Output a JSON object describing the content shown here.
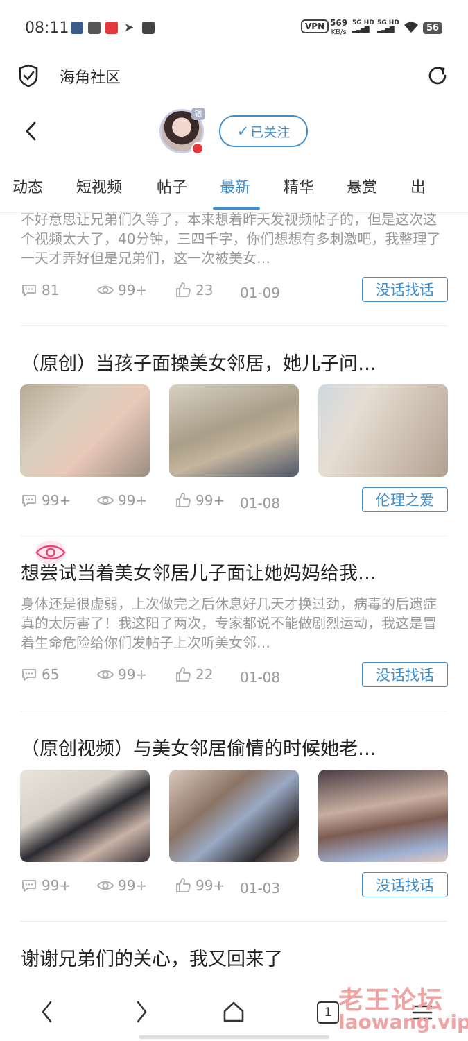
{
  "status_bar": {
    "time": "08:11",
    "net_speed": "569",
    "net_unit": "KB/s",
    "sig1": "5G HD",
    "sig2": "5G HD",
    "vpn": "VPN",
    "battery": "56"
  },
  "app": {
    "title": "海角社区"
  },
  "profile": {
    "badge": "银",
    "follow_label": "已关注"
  },
  "tabs": [
    "动态",
    "短视频",
    "帖子",
    "最新",
    "精华",
    "悬赏",
    "出"
  ],
  "active_tab_index": 3,
  "posts": [
    {
      "title": "",
      "body": "不好意思让兄弟们久等了，本来想着昨天发视频帖子的，但是这次这个视频太大了，40分钟，三四千字，你们想想有多刺激吧，我整理了一天才弄好但是兄弟们，这一次被美女…",
      "comments": "81",
      "views": "99+",
      "likes": "23",
      "date": "01-09",
      "tag": "没话找话"
    },
    {
      "title": "（原创）当孩子面操美女邻居，她儿子问…",
      "comments": "99+",
      "views": "99+",
      "likes": "99+",
      "date": "01-08",
      "tag": "伦理之爱"
    },
    {
      "title": "想尝试当着美女邻居儿子面让她妈妈给我…",
      "body": "身体还是很虚弱，上次做完之后休息好几天才换过劲，病毒的后遗症真的太厉害了！我这阳了两次，专家都说不能做剧烈运动，我这是冒着生命危险给你们发帖子上次听美女邻…",
      "comments": "65",
      "views": "99+",
      "likes": "22",
      "date": "01-08",
      "tag": "没话找话"
    },
    {
      "title": "（原创视频）与美女邻居偷情的时候她老…",
      "comments": "99+",
      "views": "99+",
      "likes": "99+",
      "date": "01-03",
      "tag": "没话找话"
    },
    {
      "title": "谢谢兄弟们的关心，我又回来了"
    }
  ],
  "nav": {
    "tab_count": "1"
  },
  "watermark": {
    "line1": "老王论坛",
    "line2": "laowang.vip"
  },
  "colors": {
    "accent": "#3e8ed0",
    "muted": "#999999"
  }
}
